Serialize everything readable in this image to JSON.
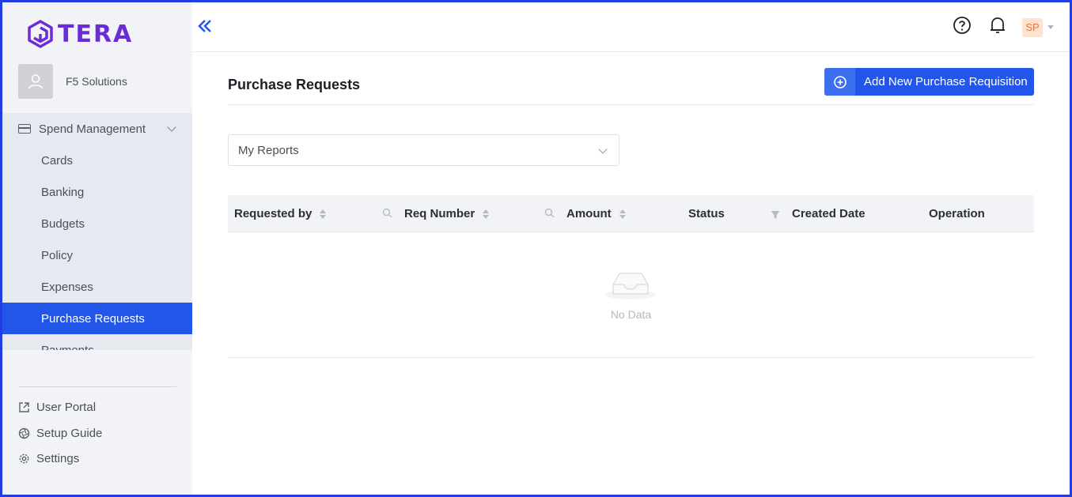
{
  "brand": {
    "name": "TERA",
    "color": "#6b2bd9"
  },
  "org": {
    "name": "F5 Solutions"
  },
  "nav": {
    "group_label": "Spend Management",
    "items": [
      {
        "label": "Cards"
      },
      {
        "label": "Banking"
      },
      {
        "label": "Budgets"
      },
      {
        "label": "Policy"
      },
      {
        "label": "Expenses"
      },
      {
        "label": "Purchase Requests",
        "active": true
      },
      {
        "label": "Payments"
      }
    ],
    "bottom": [
      {
        "label": "User Portal",
        "icon": "external-link-icon"
      },
      {
        "label": "Setup Guide",
        "icon": "aperture-icon"
      },
      {
        "label": "Settings",
        "icon": "gear-icon"
      }
    ]
  },
  "header": {
    "user_initials": "SP"
  },
  "page": {
    "title": "Purchase Requests",
    "add_button": "Add New Purchase Requisition",
    "filter_value": "My Reports"
  },
  "table": {
    "columns": [
      "Requested by",
      "Req Number",
      "Amount",
      "Status",
      "Created Date",
      "Operation"
    ],
    "empty_text": "No Data"
  },
  "colors": {
    "accent": "#2156e8",
    "sidebar_bg": "#f2f3f7",
    "menu_bg": "#e7e9f0",
    "frame": "#1f3de0"
  }
}
